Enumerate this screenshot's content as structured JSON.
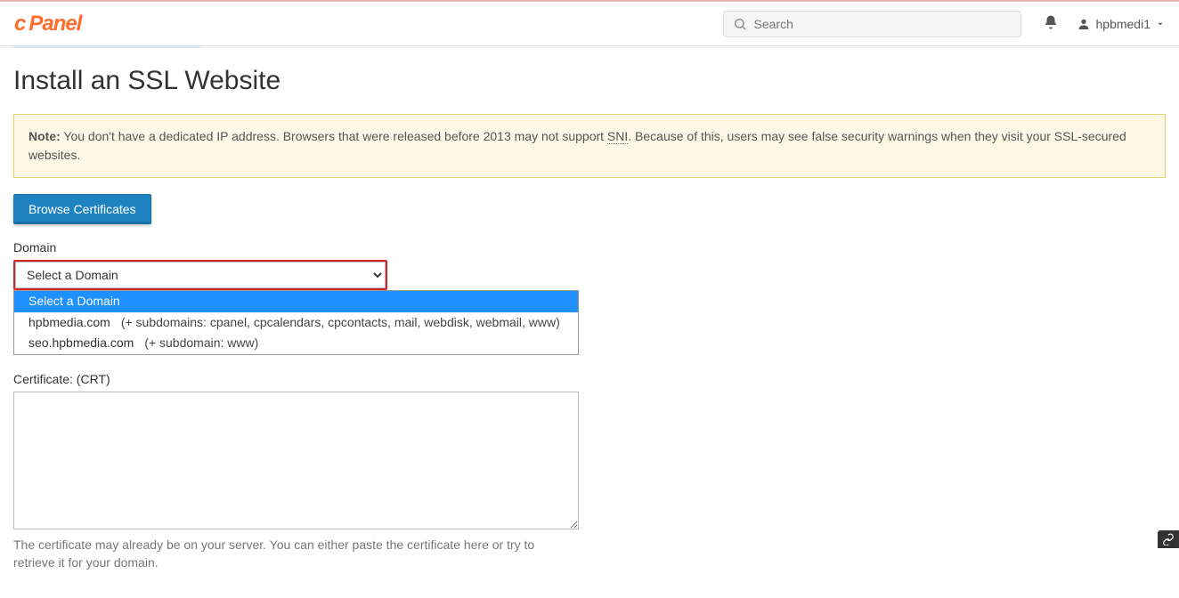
{
  "header": {
    "logo_text": "Panel",
    "search_placeholder": "Search",
    "username": "hpbmedi1"
  },
  "page": {
    "title": "Install an SSL Website",
    "alert_prefix": "Note:",
    "alert_body_1": " You don't have a dedicated IP address. Browsers that were released before 2013 may not support ",
    "alert_sni": "SNI",
    "alert_body_2": ". Because of this, users may see false security warnings when they visit your SSL-secured websites.",
    "browse_btn": "Browse Certificates",
    "domain_label": "Domain",
    "domain_selected": "Select a Domain",
    "domain_options": [
      {
        "label": "Select a Domain",
        "extra": ""
      },
      {
        "label": "hpbmedia.com",
        "extra": "(+ subdomains: cpanel, cpcalendars, cpcontacts, mail, webdisk, webmail, www)"
      },
      {
        "label": "seo.hpbmedia.com",
        "extra": "(+ subdomain: www)"
      }
    ],
    "cert_label": "Certificate: (CRT)",
    "cert_value": "",
    "cert_hint": "The certificate may already be on your server. You can either paste the certificate here or try to retrieve it for your domain."
  }
}
